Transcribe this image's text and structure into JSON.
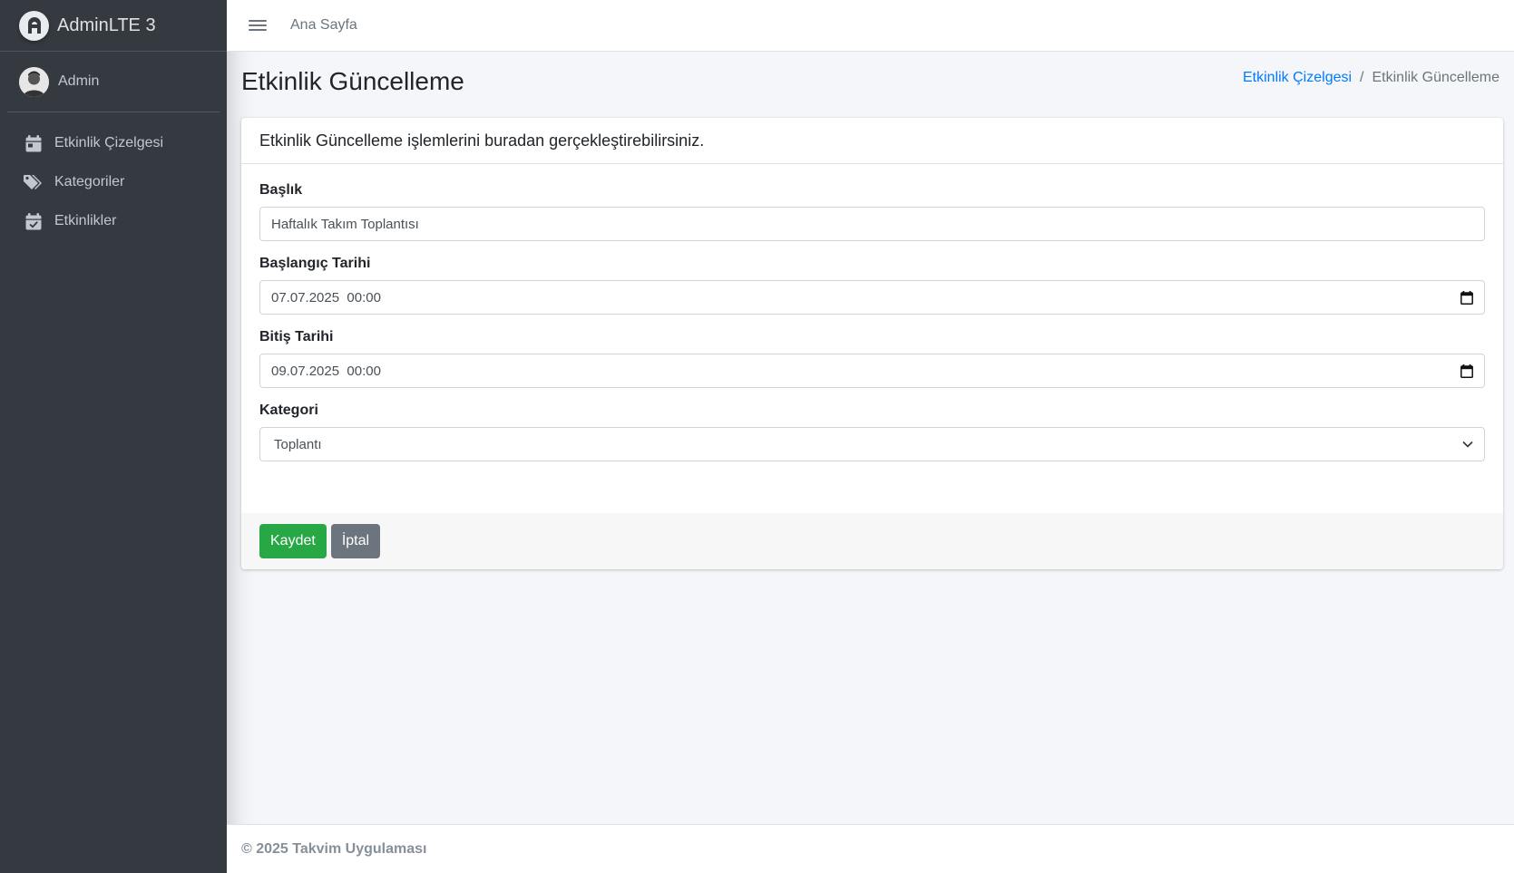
{
  "brand": {
    "name": "AdminLTE 3"
  },
  "user": {
    "name": "Admin"
  },
  "sidebar": {
    "items": [
      {
        "label": "Etkinlik Çizelgesi",
        "icon": "calendar-icon"
      },
      {
        "label": "Kategoriler",
        "icon": "tags-icon"
      },
      {
        "label": "Etkinlikler",
        "icon": "calendar-check-icon"
      }
    ]
  },
  "topbar": {
    "home_label": "Ana Sayfa"
  },
  "page": {
    "title": "Etkinlik Güncelleme",
    "breadcrumb": {
      "parent": "Etkinlik Çizelgesi",
      "separator": "/",
      "current": "Etkinlik Güncelleme"
    }
  },
  "card": {
    "header": "Etkinlik Güncelleme işlemlerini buradan gerçekleştirebilirsiniz.",
    "fields": {
      "title": {
        "label": "Başlık",
        "value": "Haftalık Takım Toplantısı"
      },
      "start": {
        "label": "Başlangıç Tarihi",
        "value": "07.07.2025  00:00"
      },
      "end": {
        "label": "Bitiş Tarihi",
        "value": "09.07.2025  00:00"
      },
      "category": {
        "label": "Kategori",
        "value": "Toplantı"
      }
    },
    "buttons": {
      "save": "Kaydet",
      "cancel": "İptal"
    }
  },
  "footer": {
    "text": "© 2025 Takvim Uygulaması"
  },
  "colors": {
    "sidebar": "#343a40",
    "primary": "#007bff",
    "success": "#28a745",
    "secondary": "#6c757d"
  }
}
